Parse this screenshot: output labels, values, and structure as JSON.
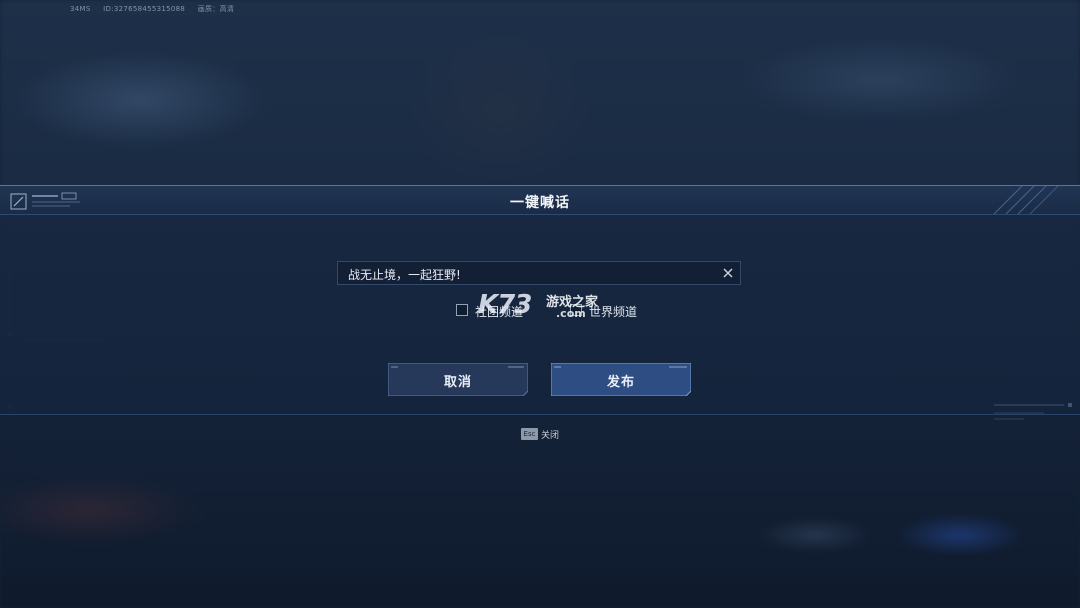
{
  "top_info": {
    "ping": "34MS",
    "id": "ID:3276584553150​88",
    "quality": "画质：高清"
  },
  "dialog": {
    "title": "一键喊话",
    "message_value": "战无止境，一起狂野!",
    "channels": [
      {
        "label": "社团频道",
        "checked": false
      },
      {
        "label": "世界频道",
        "checked": false
      }
    ],
    "cancel_label": "取消",
    "publish_label": "发布"
  },
  "watermark": {
    "brand": "K73",
    "name": "游戏之家",
    "domain": ".com"
  },
  "hint": {
    "key": "Esc",
    "label": "关闭"
  },
  "colors": {
    "accent": "#4a76b6",
    "button_cancel": "#26395a",
    "button_publish": "#2d4d83"
  }
}
